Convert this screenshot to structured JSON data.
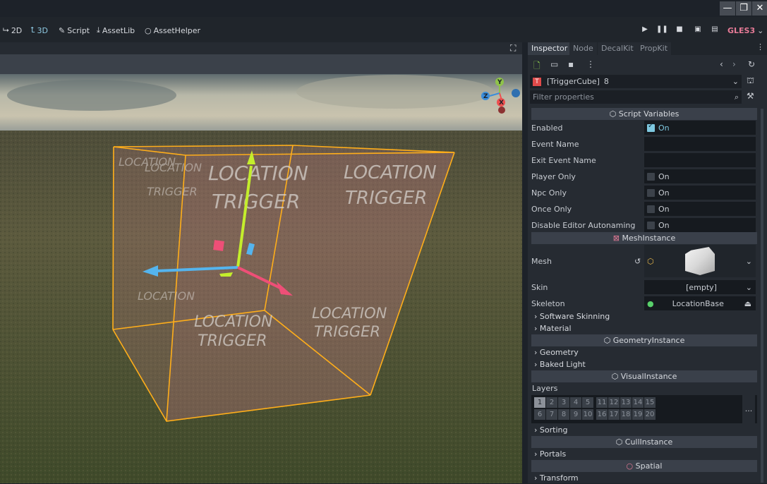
{
  "window": {
    "minimize_icon": "minimize-icon",
    "restore_icon": "restore-icon",
    "close_icon": "close-icon"
  },
  "toolbar": {
    "mode_2d": "2D",
    "mode_3d": "3D",
    "script": "Script",
    "assetlib": "AssetLib",
    "assethelper": "AssetHelper",
    "renderer": "GLES3",
    "renderer_color": "#e57a96"
  },
  "viewport": {
    "cube_label": "LOCATION TRIGGER",
    "cube_label_line1": "LOCATION",
    "cube_label_line2": "TRIGGER",
    "gizmo": {
      "x": "X",
      "y": "Y",
      "z": "Z"
    }
  },
  "inspector": {
    "tabs": [
      "Inspector",
      "Node",
      "DecalKit",
      "PropKit"
    ],
    "node_name": "[TriggerCube]",
    "node_count": "8",
    "filter_placeholder": "Filter properties",
    "script_variables": {
      "header": "Script Variables",
      "enabled_label": "Enabled",
      "enabled_value": "On",
      "event_name_label": "Event Name",
      "event_name_value": "",
      "exit_event_name_label": "Exit Event Name",
      "exit_event_name_value": "",
      "player_only_label": "Player Only",
      "player_only_value": "On",
      "npc_only_label": "Npc Only",
      "npc_only_value": "On",
      "once_only_label": "Once Only",
      "once_only_value": "On",
      "disable_autonaming_label": "Disable Editor Autonaming",
      "disable_autonaming_value": "On"
    },
    "mesh_instance": {
      "header": "MeshInstance",
      "mesh_label": "Mesh",
      "skin_label": "Skin",
      "skin_value": "[empty]",
      "skeleton_label": "Skeleton",
      "skeleton_value": "LocationBase",
      "software_skinning": "Software Skinning",
      "material": "Material"
    },
    "geometry_instance": {
      "header": "GeometryInstance",
      "geometry": "Geometry",
      "baked_light": "Baked Light"
    },
    "visual_instance": {
      "header": "VisualInstance",
      "layers_label": "Layers",
      "layers_row1": [
        "1",
        "2",
        "3",
        "4",
        "5",
        "11",
        "12",
        "13",
        "14",
        "15"
      ],
      "layers_row2": [
        "6",
        "7",
        "8",
        "9",
        "10",
        "16",
        "17",
        "18",
        "19",
        "20"
      ],
      "layers_more": "...",
      "sorting": "Sorting"
    },
    "cull_instance": {
      "header": "CullInstance",
      "portals": "Portals"
    },
    "spatial": {
      "header": "Spatial",
      "transform": "Transform"
    }
  }
}
